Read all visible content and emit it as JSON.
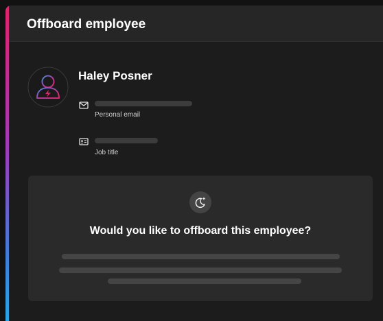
{
  "dialog": {
    "title": "Offboard employee"
  },
  "employee": {
    "name": "Haley Posner",
    "avatar_icon": "user-lightning-icon",
    "fields": [
      {
        "icon": "mail-icon",
        "label": "Personal email"
      },
      {
        "icon": "id-card-icon",
        "label": "Job title"
      }
    ]
  },
  "confirm_card": {
    "icon": "moon-sparkle-icon",
    "question": "Would you like to offboard this employee?"
  },
  "colors": {
    "accent_top": "#e0246b",
    "accent_bottom": "#2aa4e6",
    "background": "#1c1c1c",
    "card": "#2a2a2a"
  }
}
